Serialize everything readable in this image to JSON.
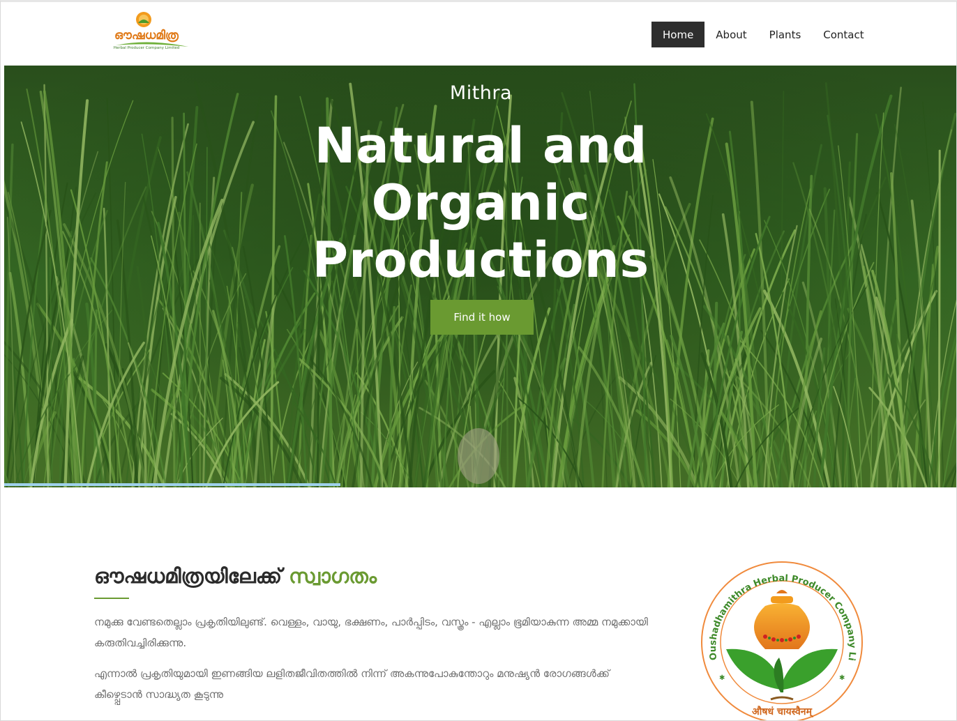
{
  "header": {
    "logo_text": "ഔഷധമിത്ര",
    "logo_subtext": "Herbal Producer Company Limited",
    "nav": [
      {
        "label": "Home",
        "active": true
      },
      {
        "label": "About",
        "active": false
      },
      {
        "label": "Plants",
        "active": false
      },
      {
        "label": "Contact",
        "active": false
      }
    ]
  },
  "hero": {
    "subtitle": "Mithra",
    "title_lines": [
      "Natural and",
      "Organic",
      "Productions"
    ],
    "button_label": "Find it how",
    "accent_color": "#6a9a31"
  },
  "welcome": {
    "heading_main": "ഔഷധമിത്രയിലേക്ക്",
    "heading_accent": "സ്വാഗതം",
    "paragraphs": [
      "നമുക്കു വേണ്ടതെല്ലാം പ്രകൃതിയിലുണ്ട്. വെള്ളം, വായു, ഭക്ഷണം, പാർപ്പിടം, വസ്ത്രം - എല്ലാം ഭൂമിയാകുന്ന അമ്മ നമുക്കായി കരുതിവച്ചിരിക്കുന്നു.",
      "എന്നാൽ പ്രകൃതിയുമായി ഇണങ്ങിയ ലളിതജീവിതത്തിൽ നിന്ന് അകന്നുപോകുന്തോറും മനുഷ്യൻ രോഗങ്ങൾക്ക് കീഴ്പ്പെടാൻ സാദ്ധ്യത കൂടുന്നു"
    ],
    "emblem_ring_text": "Oushadhamithra Herbal Producer Company Limited",
    "emblem_motto": "औषधं चायस्वैनम्"
  }
}
